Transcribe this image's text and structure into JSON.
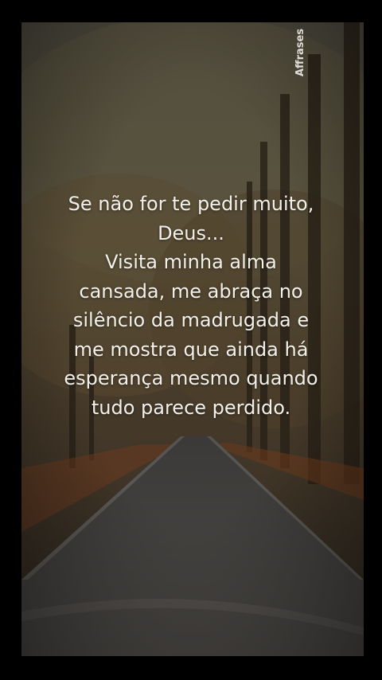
{
  "watermark": "Affrases",
  "quote": {
    "lines": [
      "Se não for te pedir muito,",
      "Deus...",
      "Visita minha alma",
      "cansada, me abraça no",
      "silêncio da madrugada e",
      "me mostra que ainda há",
      "esperança mesmo quando",
      "tudo parece perdido."
    ]
  },
  "colors": {
    "background": "#000000",
    "text": "#f2f0ea",
    "foliage": "#5a4a2e",
    "road": "#4a4744"
  }
}
